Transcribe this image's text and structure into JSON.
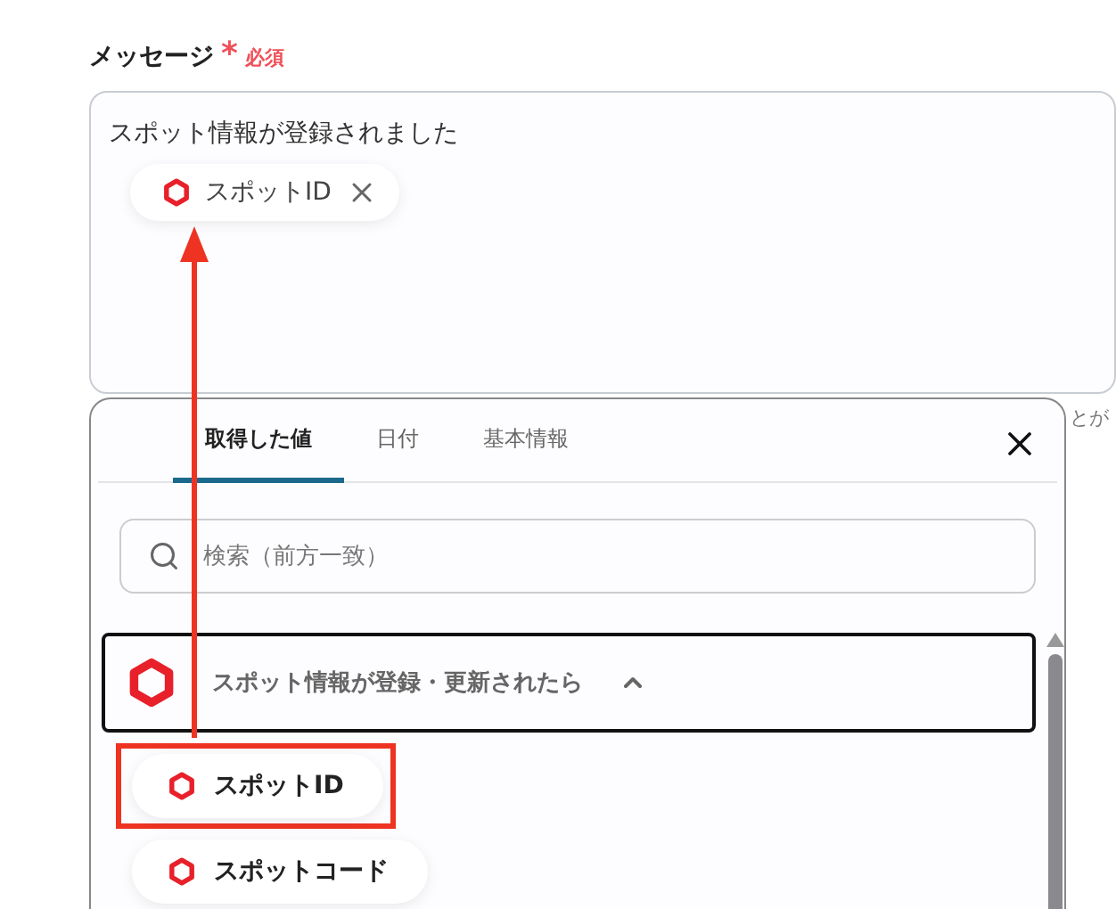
{
  "field": {
    "label": "メッセージ",
    "required_mark": "*",
    "required_text": "必須",
    "text": "スポット情報が登録されました",
    "tokens": [
      {
        "label": "スポットID"
      }
    ]
  },
  "side_text": "とが",
  "picker": {
    "tabs": [
      {
        "label": "取得した値",
        "selected": true
      },
      {
        "label": "日付",
        "selected": false
      },
      {
        "label": "基本情報",
        "selected": false
      }
    ],
    "search": {
      "placeholder": "検索（前方一致）"
    },
    "group": {
      "title": "スポット情報が登録・更新されたら",
      "expanded": true,
      "items": [
        {
          "label": "スポットID",
          "highlighted": true
        },
        {
          "label": "スポットコード",
          "highlighted": false
        }
      ]
    }
  }
}
